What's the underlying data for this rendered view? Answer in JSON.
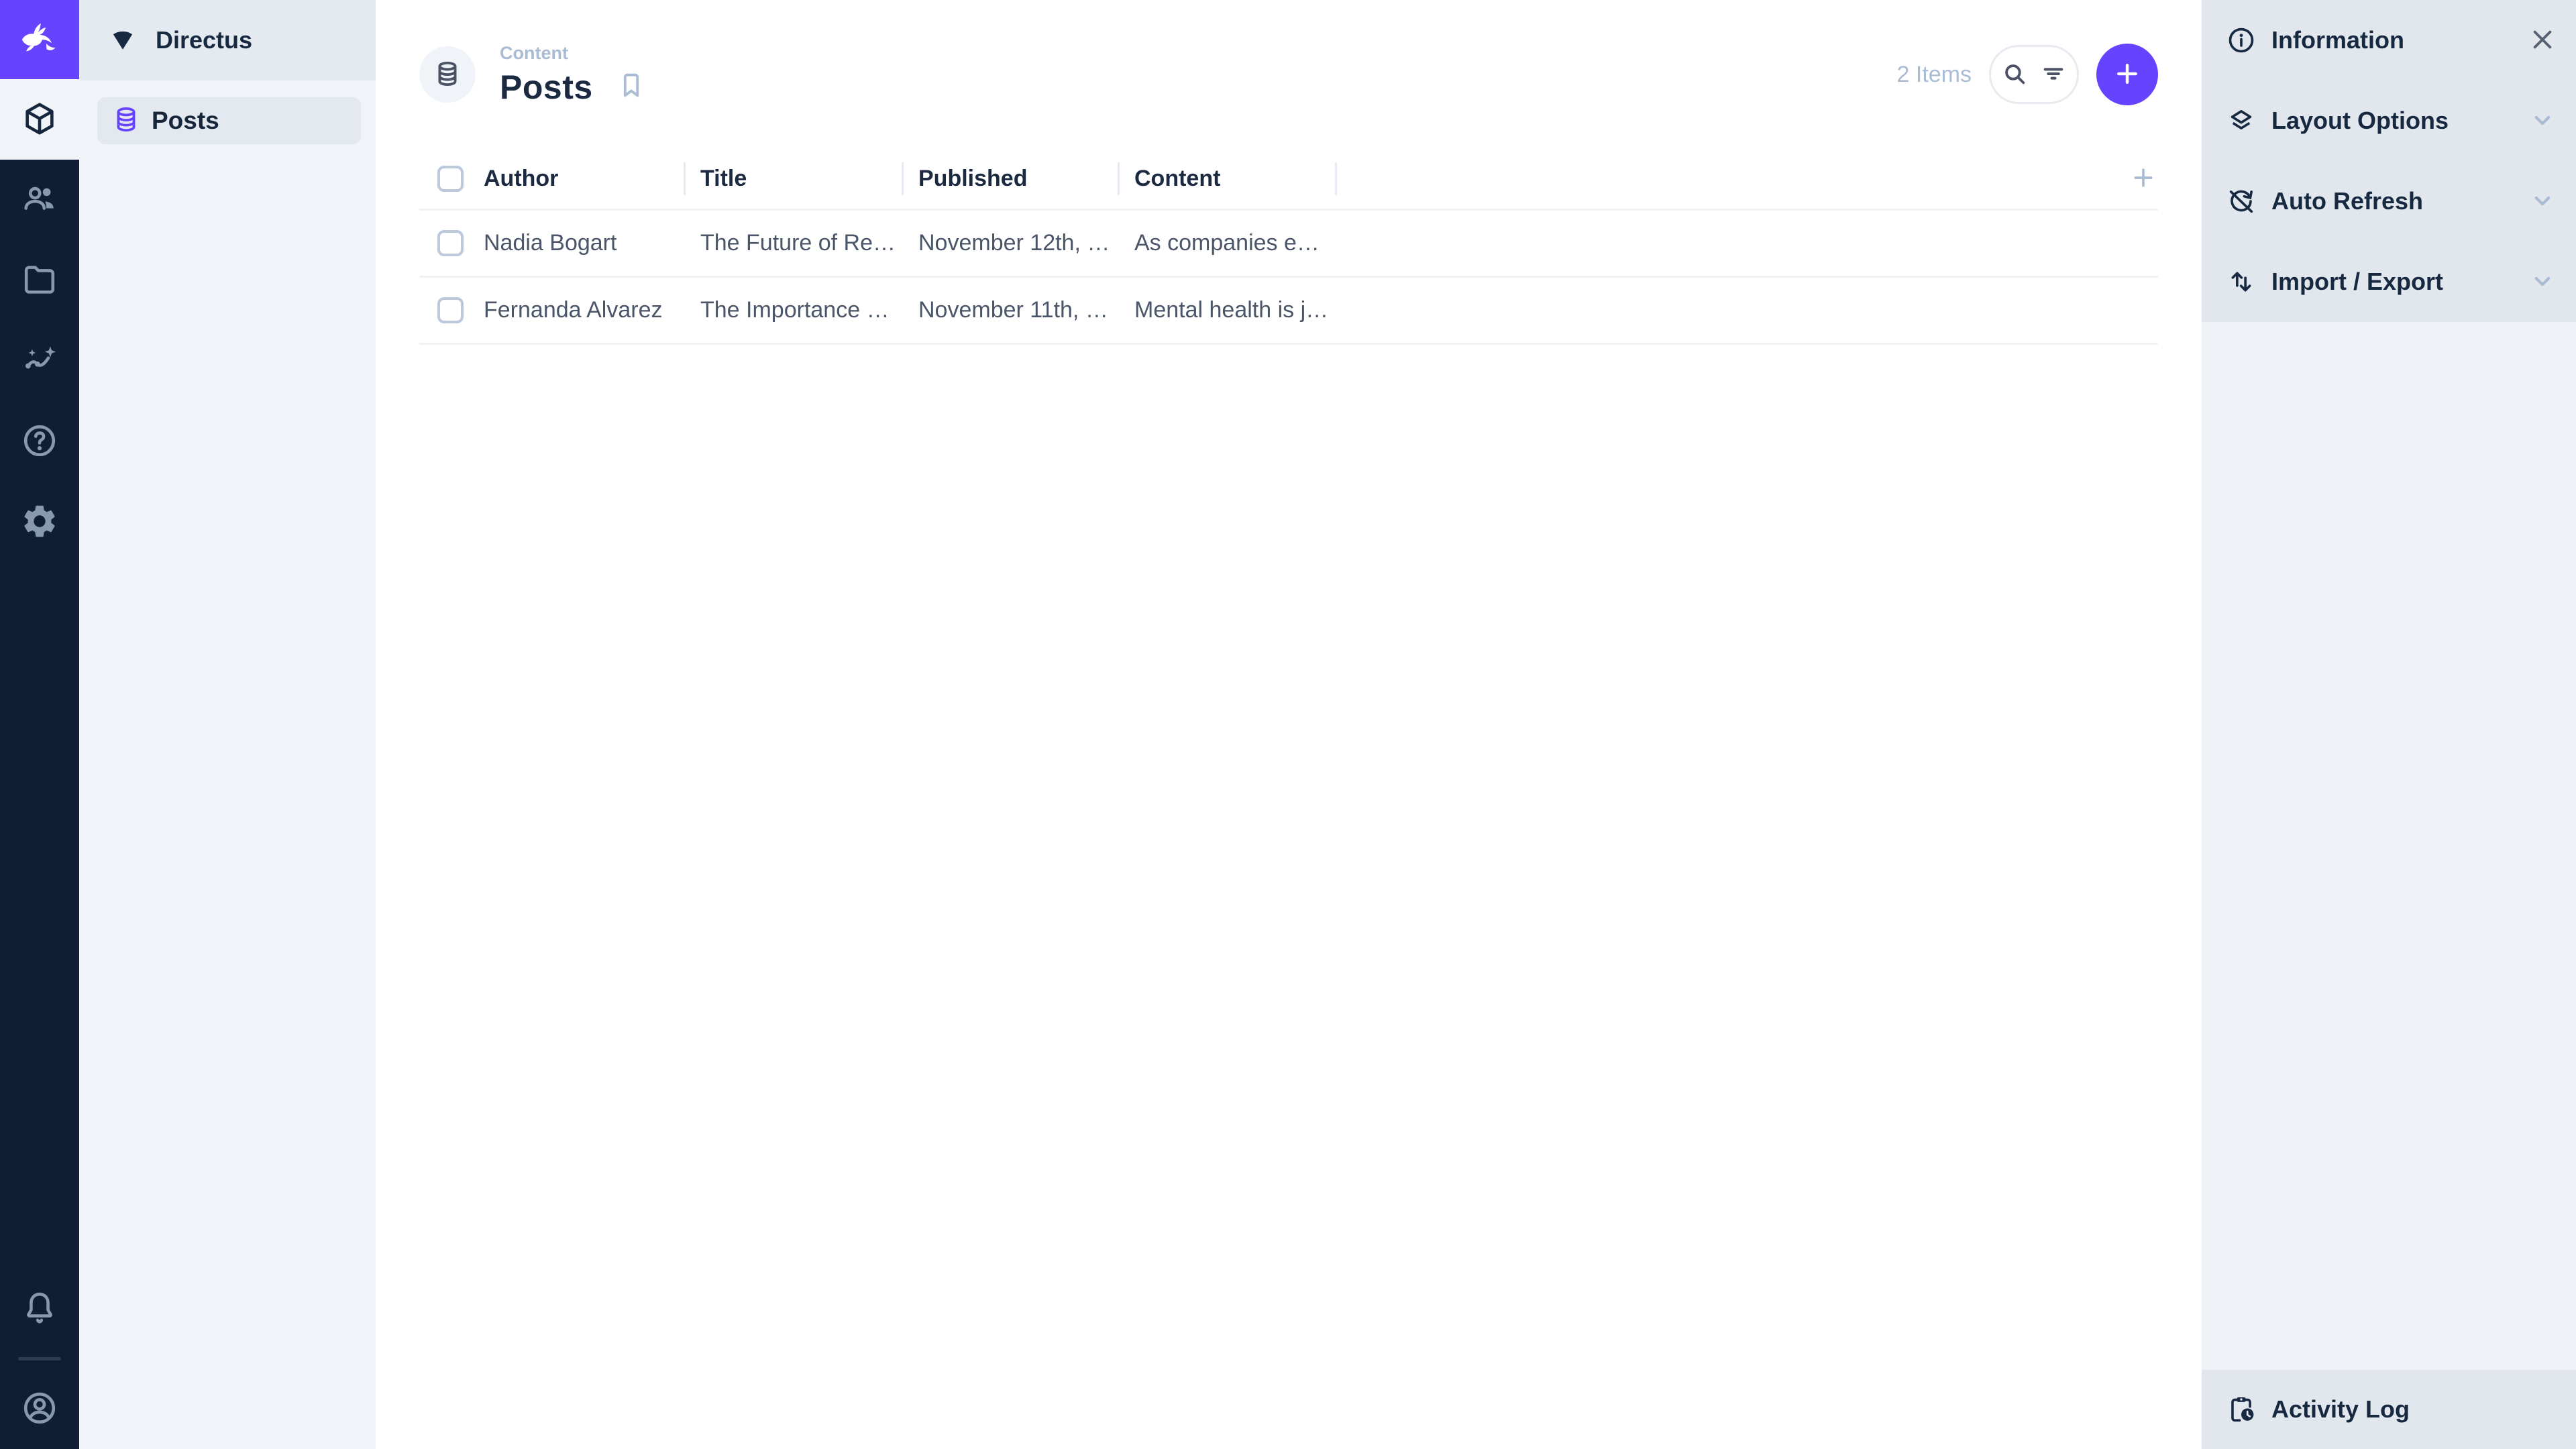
{
  "colors": {
    "accent": "#6644FF",
    "module_bar_bg": "#0F1E33",
    "module_icon": "#8799AF",
    "dark_text": "#172940",
    "muted_text": "#A9BCD4",
    "cell_text": "#4A5568",
    "nav_bg": "#F0F4F9",
    "panel_bg": "#E2E7EE",
    "border": "#E7EBF1"
  },
  "module_bar": {
    "logo_icon": "directus-rabbit-icon",
    "modules": [
      {
        "icon": "content-module-cube-icon",
        "active": true
      },
      {
        "icon": "user-directory-people-icon",
        "active": false
      },
      {
        "icon": "file-library-folder-icon",
        "active": false
      },
      {
        "icon": "insights-icon",
        "active": false
      },
      {
        "icon": "help-icon",
        "active": false
      },
      {
        "icon": "settings-gear-icon",
        "active": false
      }
    ],
    "bottom": [
      {
        "icon": "notifications-bell-icon"
      },
      {
        "icon": "account-circle-icon"
      }
    ]
  },
  "nav_sidebar": {
    "project_name": "Directus",
    "project_icon": "project-fan-icon",
    "items": [
      {
        "label": "Posts",
        "icon": "database-icon",
        "active": true
      }
    ]
  },
  "header": {
    "collection_icon": "database-icon",
    "breadcrumb": "Content",
    "title": "Posts",
    "bookmark_icon": "bookmark-icon",
    "items_count": "2 Items",
    "search_icon": "search-icon",
    "filter_icon": "filter-icon",
    "add_icon": "plus-icon"
  },
  "table": {
    "columns": [
      "Author",
      "Title",
      "Published",
      "Content"
    ],
    "rows": [
      {
        "author": "Nadia Bogart",
        "title": "The Future of Re…",
        "published": "November 12th, …",
        "content": "As companies e…"
      },
      {
        "author": "Fernanda Alvarez",
        "title": "The Importance …",
        "published": "November 11th, …",
        "content": "Mental health is j…"
      }
    ]
  },
  "sidebar": {
    "sections": [
      {
        "label": "Information",
        "icon": "info-icon",
        "control": "close"
      },
      {
        "label": "Layout Options",
        "icon": "layers-icon",
        "control": "chevron-down"
      },
      {
        "label": "Auto Refresh",
        "icon": "sync-disabled-icon",
        "control": "chevron-down"
      },
      {
        "label": "Import / Export",
        "icon": "swap-vertical-icon",
        "control": "chevron-down"
      }
    ],
    "footer": {
      "label": "Activity Log",
      "icon": "activity-log-clipboard-icon"
    }
  }
}
